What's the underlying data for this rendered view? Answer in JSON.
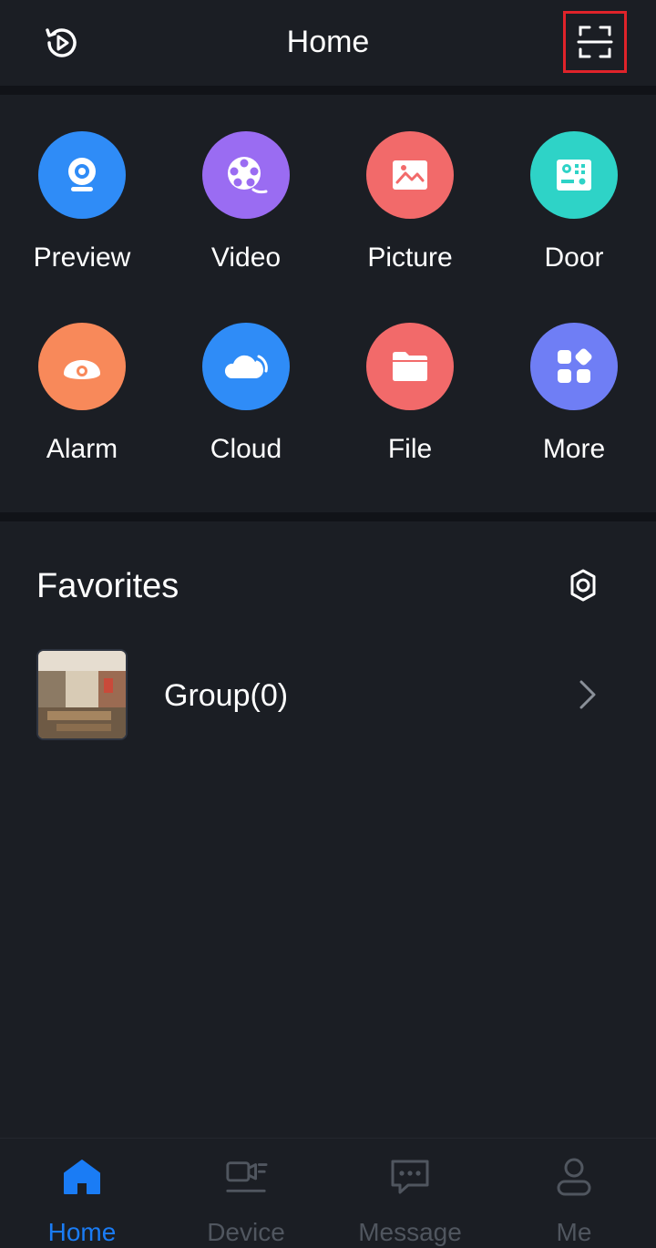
{
  "header": {
    "title": "Home",
    "history_icon": "history-play-icon",
    "scan_icon": "scan-icon"
  },
  "features": [
    {
      "label": "Preview",
      "icon": "camera-icon",
      "color": "#2f8cf7"
    },
    {
      "label": "Video",
      "icon": "film-reel-icon",
      "color": "#9a6cf2"
    },
    {
      "label": "Picture",
      "icon": "image-icon",
      "color": "#f26a6a"
    },
    {
      "label": "Door",
      "icon": "door-panel-icon",
      "color": "#2ed3c7"
    },
    {
      "label": "Alarm",
      "icon": "alarm-icon",
      "color": "#f8895a"
    },
    {
      "label": "Cloud",
      "icon": "cloud-icon",
      "color": "#2f8cf7"
    },
    {
      "label": "File",
      "icon": "folder-icon",
      "color": "#f26a6a"
    },
    {
      "label": "More",
      "icon": "apps-icon",
      "color": "#6f7ef5"
    }
  ],
  "favorites": {
    "title": "Favorites",
    "settings_icon": "gear-icon",
    "groups": [
      {
        "label": "Group(0)"
      }
    ]
  },
  "tabbar": {
    "tabs": [
      {
        "label": "Home",
        "icon": "home-icon",
        "active": true
      },
      {
        "label": "Device",
        "icon": "device-camera-icon",
        "active": false
      },
      {
        "label": "Message",
        "icon": "message-icon",
        "active": false
      },
      {
        "label": "Me",
        "icon": "user-icon",
        "active": false
      }
    ],
    "active_color": "#1a7cf5",
    "inactive_color": "#50565f"
  }
}
